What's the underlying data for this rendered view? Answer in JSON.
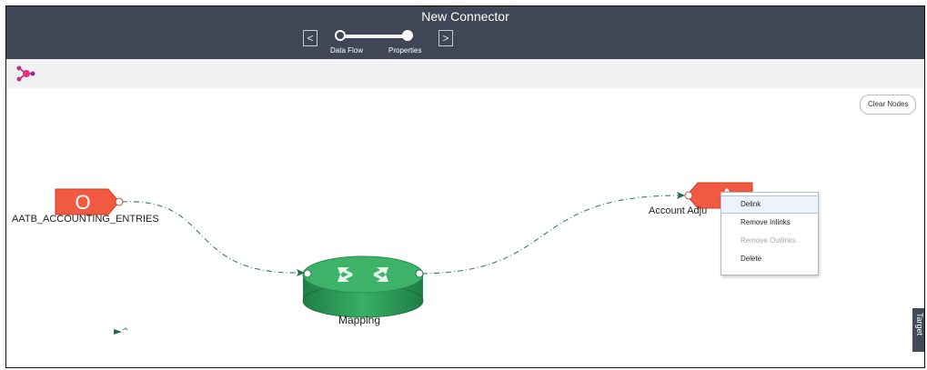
{
  "header": {
    "title": "New Connector",
    "prev_icon": "<",
    "next_icon": ">",
    "steps": [
      {
        "label": "Data Flow"
      },
      {
        "label": "Properties"
      }
    ]
  },
  "toolbar": {
    "icon": "connector-icon"
  },
  "canvas": {
    "clear_nodes_label": "Clear Nodes",
    "source_node": {
      "letter": "O",
      "label": "AATB_ACCOUNTING_ENTRIES",
      "color": "#f05a42"
    },
    "target_node": {
      "letter": "A",
      "label": "Account Adju",
      "color": "#f05a42"
    },
    "mapping_node": {
      "label": "Mapping",
      "color": "#2fa55e"
    },
    "wire_color": "#3f8a6a"
  },
  "context_menu": {
    "items": [
      {
        "label": "Delink"
      },
      {
        "label": "Remove Inlinks"
      },
      {
        "label": "Remove Outlinks"
      },
      {
        "label": "Delete"
      }
    ]
  },
  "side_tab": {
    "label": "Target"
  }
}
